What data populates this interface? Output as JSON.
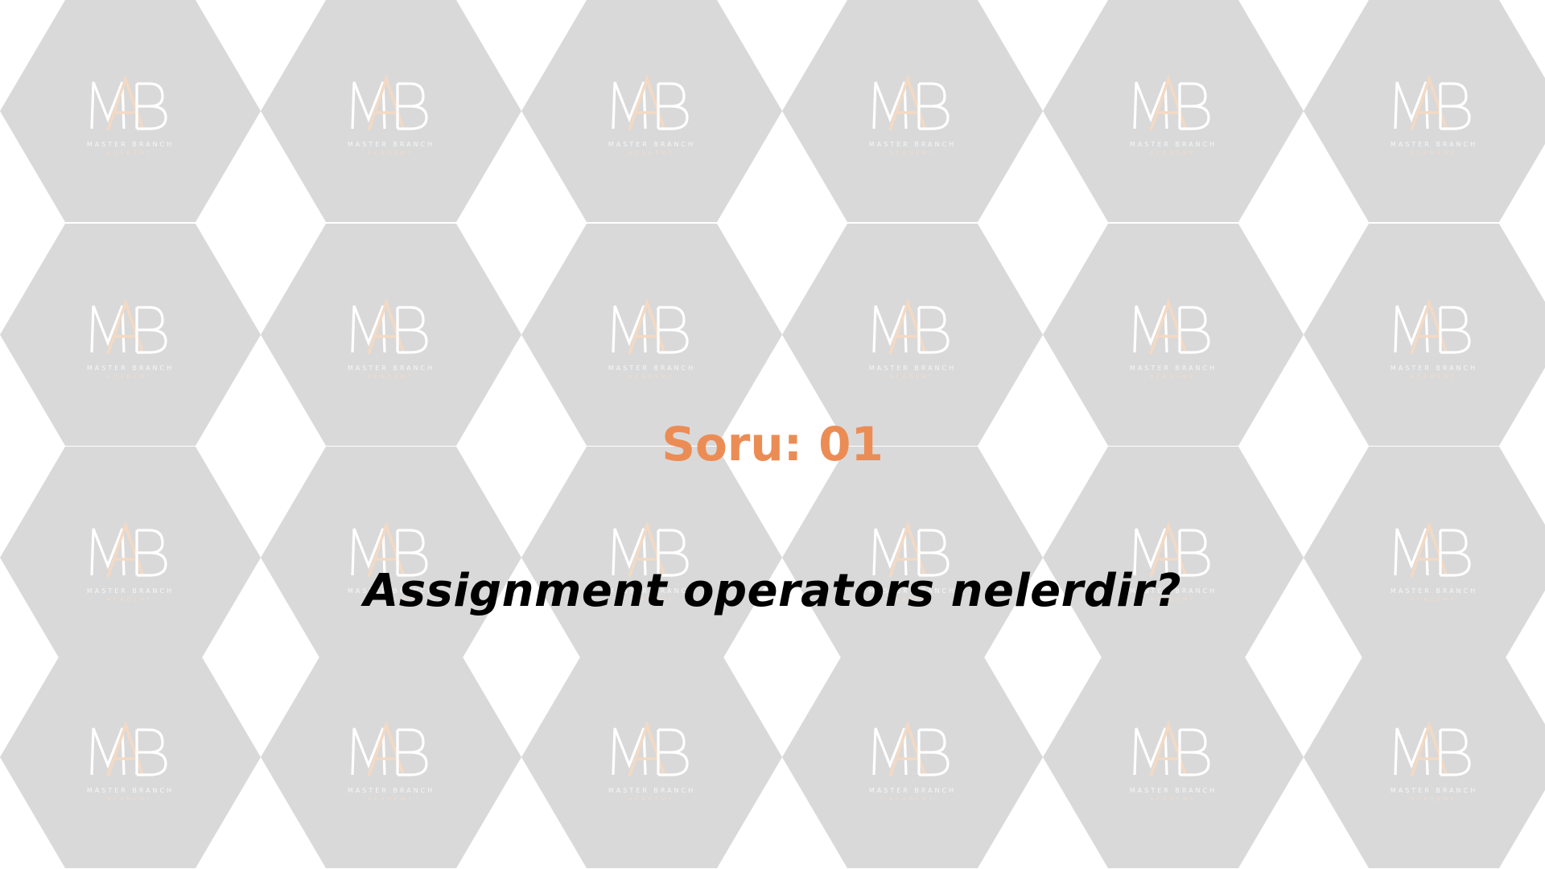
{
  "slide": {
    "question_number": "Soru: 01",
    "question_text": "Assignment operators nelerdir?"
  },
  "background": {
    "pattern": "hexagon-tiles",
    "tile_color": "#d9d9d9",
    "page_color": "#ffffff",
    "watermark": {
      "monogram": "MAB",
      "name": "MASTER BRANCH",
      "subtitle": "ACADEMY",
      "accent_color": "#f3d9c4"
    }
  },
  "colors": {
    "question_number": "#ec8c55",
    "question_text": "#000000"
  }
}
